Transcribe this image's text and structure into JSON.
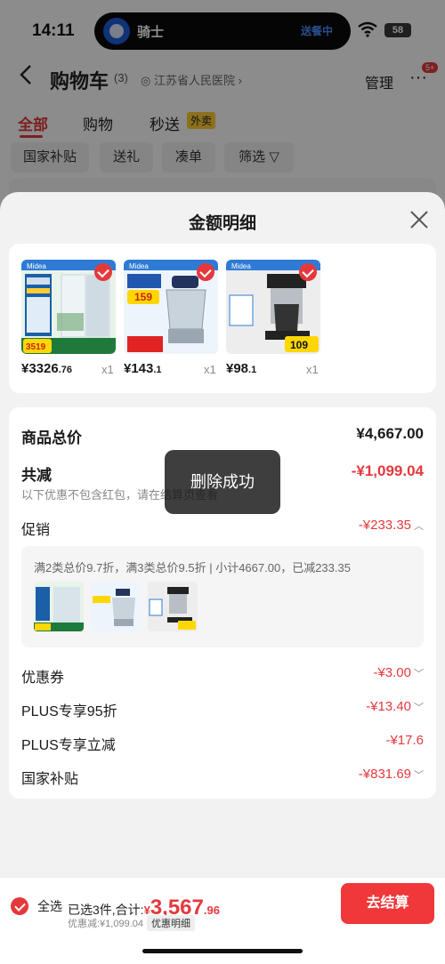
{
  "status_bar": {
    "time": "14:11",
    "battery": "58"
  },
  "live_activity": {
    "title": "骑士",
    "status": "送餐中"
  },
  "header": {
    "title": "购物车",
    "count": "(3)",
    "location": "江苏省人民医院",
    "manage": "管理",
    "more_badge": "5+"
  },
  "tabs": [
    {
      "label": "全部"
    },
    {
      "label": "购物"
    },
    {
      "label": "秒送"
    }
  ],
  "tab_tag": "外卖",
  "chips": [
    {
      "label": "国家补贴"
    },
    {
      "label": "送礼"
    },
    {
      "label": "凑单"
    },
    {
      "label": "筛选"
    }
  ],
  "sheet": {
    "title": "金额明细"
  },
  "products": [
    {
      "price_main": "¥3326",
      "price_dec": ".76",
      "qty": "x1",
      "img_tag": "3519"
    },
    {
      "price_main": "¥143",
      "price_dec": ".1",
      "qty": "x1",
      "img_tag": "159"
    },
    {
      "price_main": "¥98",
      "price_dec": ".1",
      "qty": "x1",
      "img_tag": "109"
    }
  ],
  "breakdown": {
    "total_label": "商品总价",
    "total_value": "¥4,667.00",
    "reduce_label": "共减",
    "reduce_value": "-¥1,099.04",
    "reduce_note": "以下优惠不包含红包，请在结算页查看",
    "promo_label": "促销",
    "promo_value": "-¥233.35",
    "promo_detail": "满2类总价9.7折，满3类总价9.5折 | 小计4667.00，已减233.35",
    "coupon_label": "优惠券",
    "coupon_value": "-¥3.00",
    "plus95_label": "PLUS专享95折",
    "plus95_value": "-¥13.40",
    "plusinstant_label": "PLUS专享立减",
    "plusinstant_value": "-¥17.6",
    "subsidy_label": "国家补贴",
    "subsidy_value": "-¥831.69"
  },
  "toast": "删除成功",
  "bottom": {
    "select_all": "全选",
    "selected": "已选3件,合计:",
    "currency": "¥",
    "total_big": "3,567",
    "total_small": ".96",
    "discount": "优惠减:¥1,099.04",
    "detail_tag": "优惠明细",
    "checkout": "去结算"
  },
  "colors": {
    "accent": "#e4393c",
    "checkout": "#f0373a"
  }
}
